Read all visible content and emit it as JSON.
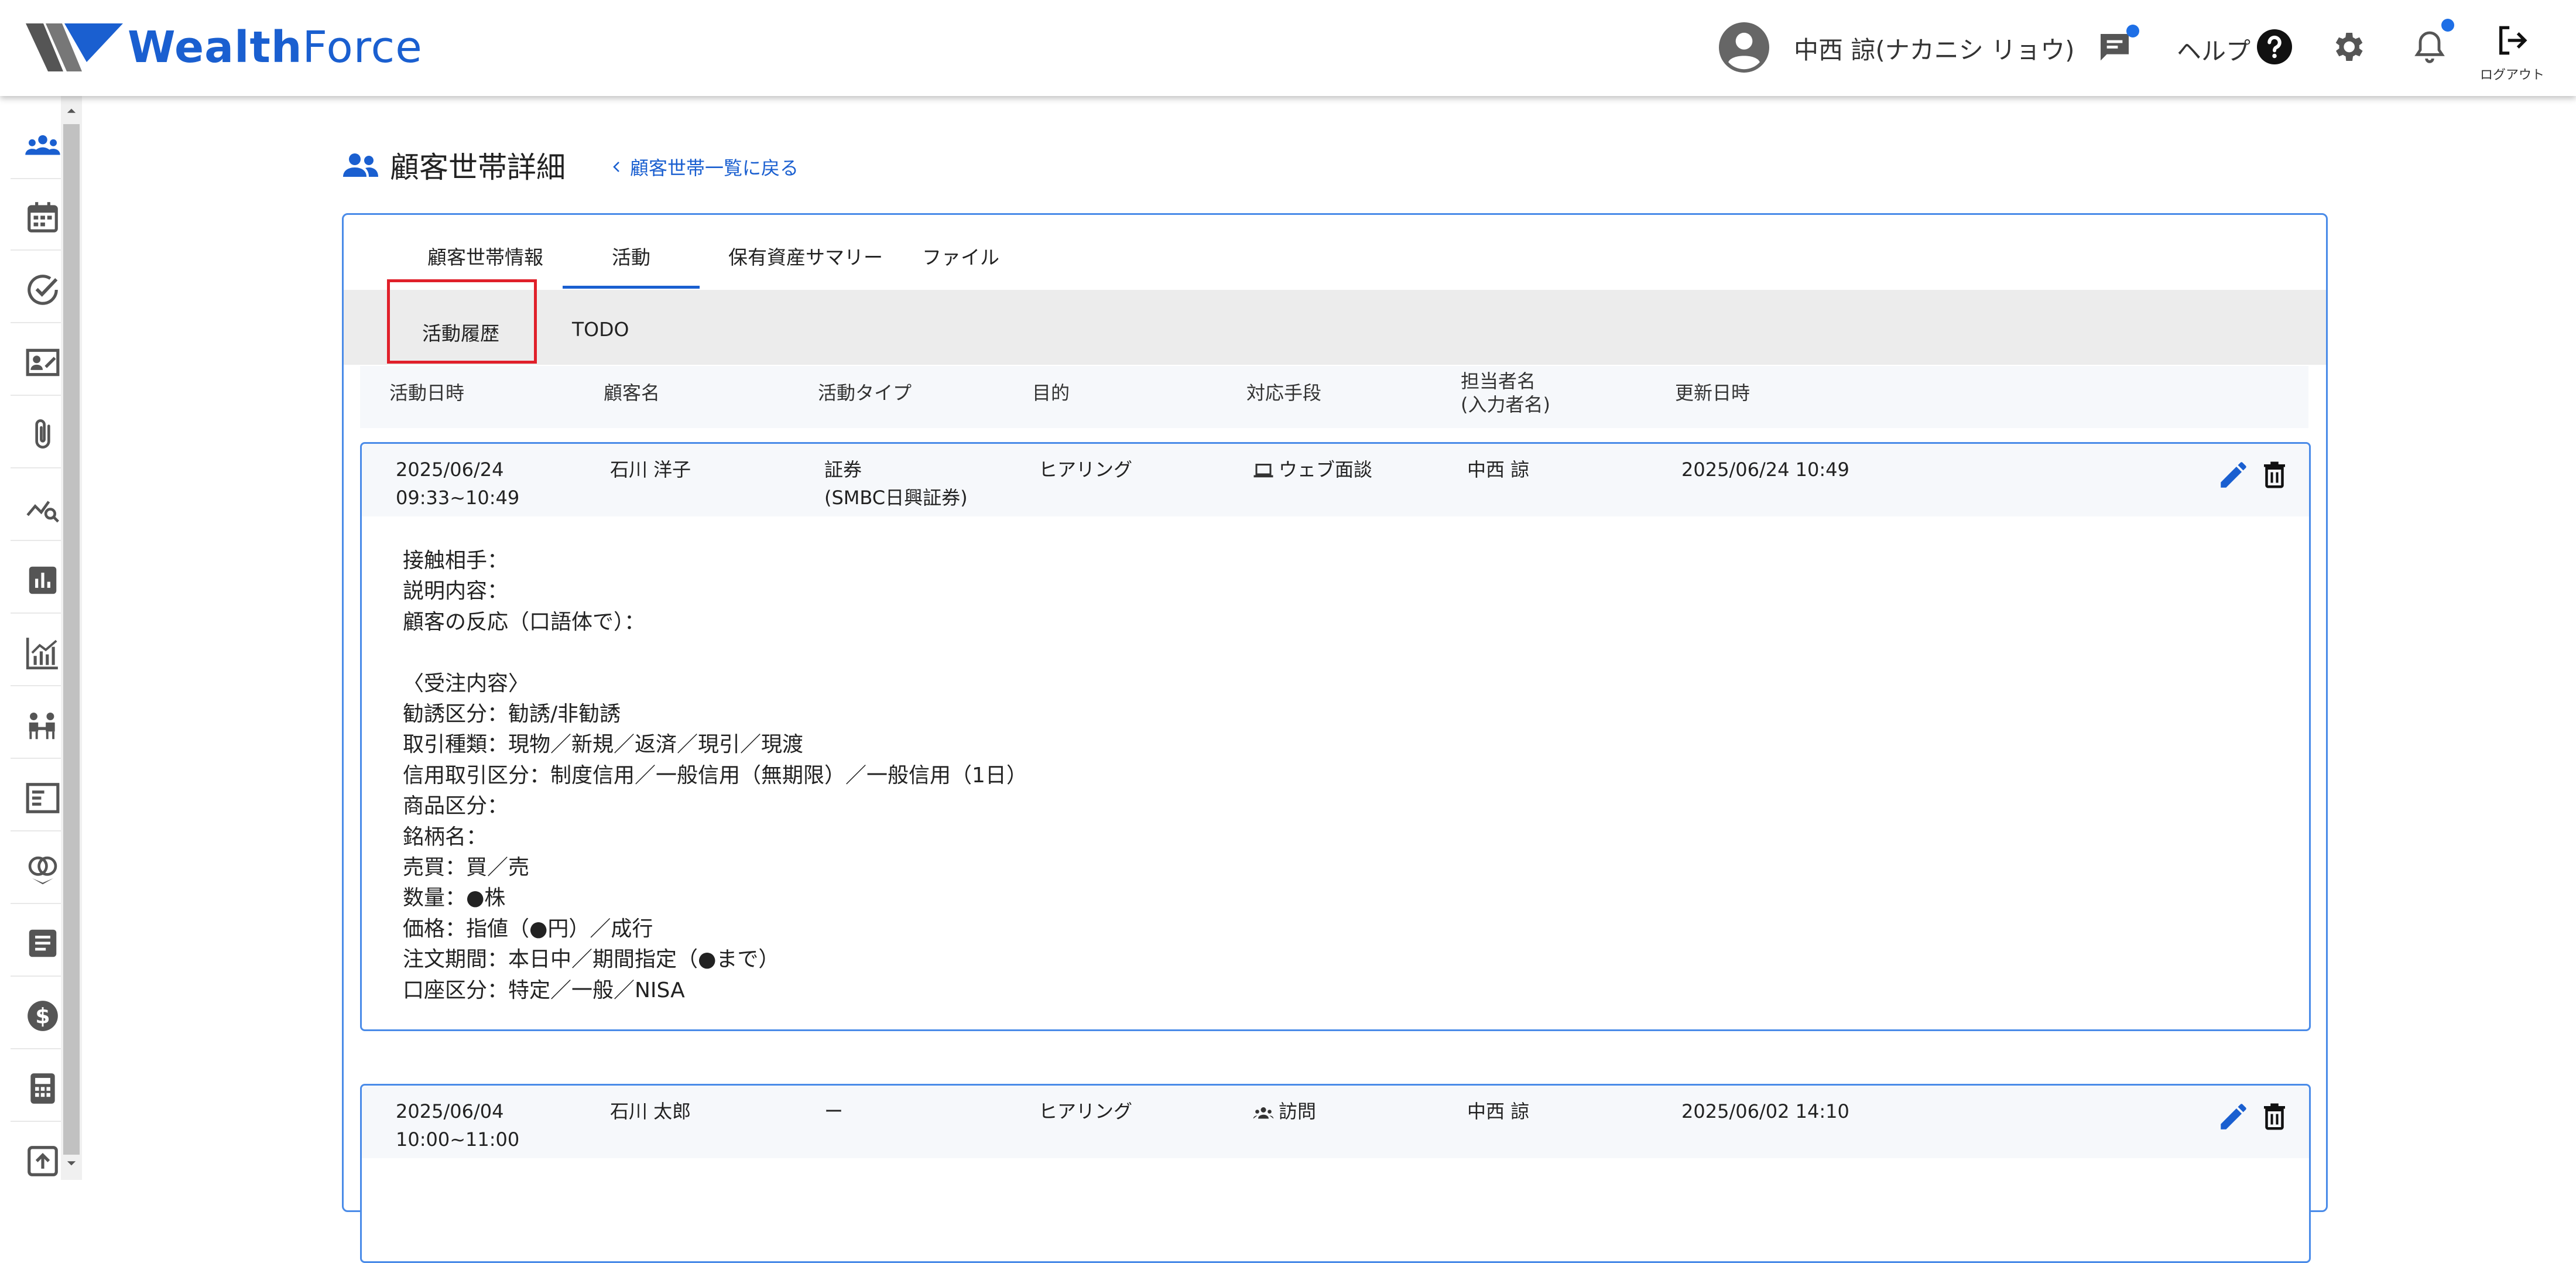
{
  "header": {
    "logo_bold": "Wealth",
    "logo_light": "Force",
    "user_name": "中西 諒(ナカニシ リョウ)",
    "help_label": "ヘルプ",
    "logout_label": "ログアウト"
  },
  "page": {
    "title": "顧客世帯詳細",
    "back_link": "顧客世帯一覧に戻る"
  },
  "tabs": [
    {
      "label": "顧客世帯情報"
    },
    {
      "label": "活動"
    },
    {
      "label": "保有資産サマリー"
    },
    {
      "label": "ファイル"
    }
  ],
  "subtabs": [
    {
      "label": "活動履歴"
    },
    {
      "label": "TODO"
    }
  ],
  "columns": {
    "date": "活動日時",
    "customer": "顧客名",
    "type": "活動タイプ",
    "purpose": "目的",
    "method": "対応手段",
    "staff_line1": "担当者名",
    "staff_line2": "(入力者名)",
    "updated": "更新日時"
  },
  "activities": [
    {
      "date": "2025/06/24",
      "time": "09:33~10:49",
      "customer": "石川 洋子",
      "type": "証券",
      "type_sub": "(SMBC日興証券)",
      "purpose": "ヒアリング",
      "method": "ウェブ面談",
      "method_icon": "laptop-icon",
      "staff": "中西 諒",
      "updated": "2025/06/24 10:49",
      "memo": "接触相手：\n説明内容：\n顧客の反応（口語体で）：\n\n〈受注内容〉\n勧誘区分：勧誘/非勧誘\n取引種類：現物／新規／返済／現引／現渡\n信用取引区分：制度信用／一般信用（無期限）／一般信用（1日）\n商品区分：\n銘柄名：\n売買：買／売\n数量：●株\n価格：指値（●円）／成行\n注文期間：本日中／期間指定（●まで）\n口座区分：特定／一般／NISA"
    },
    {
      "date": "2025/06/04",
      "time": "10:00~11:00",
      "customer": "石川 太郎",
      "type": "ー",
      "type_sub": "",
      "purpose": "ヒアリング",
      "method": "訪問",
      "method_icon": "people-icon",
      "staff": "中西 諒",
      "updated": "2025/06/02 14:10",
      "memo": ""
    }
  ],
  "colors": {
    "brand": "#1a5fd0",
    "border": "#4a8be8",
    "highlight": "#e0202a"
  },
  "sidebar_icons": [
    "users-icon",
    "calendar-icon",
    "check-circle-icon",
    "contact-card-icon",
    "paperclip-icon",
    "chart-search-icon",
    "bar-chart-icon",
    "analytics-icon",
    "meeting-icon",
    "news-icon",
    "rings-icon",
    "document-icon",
    "dollar-icon",
    "calculator-icon",
    "upload-icon"
  ]
}
